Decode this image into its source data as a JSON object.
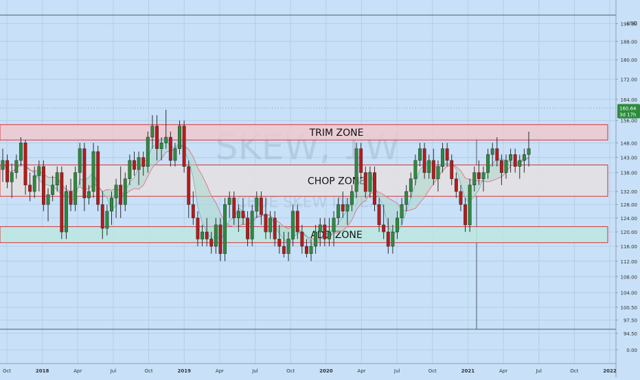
{
  "chart_data": {
    "type": "candlestick",
    "watermark": {
      "symbol": "SKEW, 1W",
      "name": "CBOE SKEW INDEX"
    },
    "currency": "USD",
    "y_scale": "log",
    "ylim": [
      88,
      200
    ],
    "y_ticks": [
      "0.00",
      "94.50",
      "97.50",
      "100.50",
      "104.00",
      "108.00",
      "112.00",
      "116.00",
      "120.00",
      "124.00",
      "128.00",
      "132.00",
      "138.00",
      "143.00",
      "148.00",
      "156.00",
      "164.00",
      "172.00",
      "180.00",
      "188.00",
      "196.00"
    ],
    "x_ticks": [
      "Oct",
      "2018",
      "Apr",
      "Jul",
      "Oct",
      "2019",
      "Apr",
      "Jul",
      "Oct",
      "2020",
      "Apr",
      "Jul",
      "Oct",
      "2021",
      "Apr",
      "Jul",
      "Oct",
      "2022"
    ],
    "last_price": {
      "value": "160.64",
      "countdown": "3d 17h"
    },
    "zones": [
      {
        "label": "TRIM ZONE",
        "from": 149,
        "to": 154.5,
        "color": "#f0c8cf"
      },
      {
        "label": "CHOP ZONE",
        "from": 130.5,
        "to": 140.5,
        "color": "#e5e0e2"
      },
      {
        "label": "ADD ZONE",
        "from": 117.0,
        "to": 121.5,
        "color": "#bce6e0"
      }
    ],
    "series": [
      {
        "name": "",
        "values": [
          [
            139,
            146,
            135,
            142
          ],
          [
            142,
            144,
            133,
            135
          ],
          [
            135,
            141,
            130,
            138
          ],
          [
            138,
            144,
            136,
            142
          ],
          [
            142,
            150,
            140,
            148
          ],
          [
            148,
            149,
            131,
            134
          ],
          [
            134,
            138,
            129,
            132
          ],
          [
            132,
            140,
            130,
            137
          ],
          [
            137,
            142,
            132,
            140
          ],
          [
            140,
            142,
            126,
            128
          ],
          [
            128,
            133,
            123,
            131
          ],
          [
            131,
            137,
            129,
            134
          ],
          [
            134,
            140,
            132,
            138
          ],
          [
            138,
            140,
            118,
            120
          ],
          [
            120,
            134,
            118,
            132
          ],
          [
            132,
            136,
            126,
            128
          ],
          [
            128,
            140,
            126,
            138
          ],
          [
            138,
            148,
            134,
            146
          ],
          [
            146,
            148,
            126,
            130
          ],
          [
            130,
            134,
            128,
            132
          ],
          [
            132,
            148,
            130,
            145
          ],
          [
            145,
            147,
            126,
            128
          ],
          [
            128,
            132,
            118,
            121
          ],
          [
            121,
            128,
            119,
            126
          ],
          [
            126,
            132,
            122,
            130
          ],
          [
            130,
            136,
            124,
            134
          ],
          [
            134,
            140,
            124,
            128
          ],
          [
            128,
            138,
            126,
            136
          ],
          [
            136,
            144,
            134,
            142
          ],
          [
            142,
            145,
            137,
            139
          ],
          [
            139,
            145,
            134,
            143
          ],
          [
            143,
            145,
            137,
            140
          ],
          [
            140,
            152,
            138,
            150
          ],
          [
            150,
            158,
            146,
            154
          ],
          [
            154,
            158,
            142,
            146
          ],
          [
            146,
            150,
            142,
            148
          ],
          [
            148,
            160,
            146,
            150
          ],
          [
            150,
            152,
            140,
            142
          ],
          [
            142,
            148,
            140,
            146
          ],
          [
            146,
            156,
            144,
            154
          ],
          [
            154,
            156,
            138,
            140
          ],
          [
            140,
            142,
            124,
            128
          ],
          [
            128,
            132,
            122,
            124
          ],
          [
            124,
            126,
            116,
            118
          ],
          [
            118,
            122,
            116,
            120
          ],
          [
            120,
            124,
            116,
            118
          ],
          [
            118,
            120,
            114,
            116
          ],
          [
            116,
            124,
            114,
            122
          ],
          [
            122,
            124,
            112,
            114
          ],
          [
            114,
            130,
            112,
            128
          ],
          [
            128,
            132,
            124,
            130
          ],
          [
            130,
            132,
            122,
            124
          ],
          [
            124,
            128,
            120,
            126
          ],
          [
            126,
            130,
            122,
            124
          ],
          [
            124,
            126,
            116,
            118
          ],
          [
            118,
            128,
            116,
            126
          ],
          [
            126,
            132,
            124,
            130
          ],
          [
            130,
            132,
            122,
            125
          ],
          [
            125,
            130,
            118,
            120
          ],
          [
            120,
            126,
            118,
            124
          ],
          [
            124,
            126,
            116,
            118
          ],
          [
            118,
            122,
            114,
            116
          ],
          [
            116,
            120,
            113,
            114
          ],
          [
            114,
            120,
            112,
            118
          ],
          [
            118,
            128,
            116,
            126
          ],
          [
            126,
            128,
            118,
            120
          ],
          [
            120,
            122,
            114,
            116
          ],
          [
            116,
            118,
            113,
            114
          ],
          [
            114,
            118,
            112,
            116
          ],
          [
            116,
            122,
            114,
            120
          ],
          [
            120,
            124,
            116,
            122
          ],
          [
            122,
            124,
            116,
            118
          ],
          [
            118,
            124,
            116,
            120
          ],
          [
            120,
            126,
            116,
            124
          ],
          [
            124,
            130,
            122,
            128
          ],
          [
            128,
            132,
            124,
            126
          ],
          [
            126,
            130,
            122,
            128
          ],
          [
            128,
            134,
            126,
            132
          ],
          [
            132,
            148,
            130,
            146
          ],
          [
            146,
            148,
            136,
            138
          ],
          [
            138,
            140,
            130,
            132
          ],
          [
            132,
            140,
            130,
            138
          ],
          [
            138,
            140,
            126,
            128
          ],
          [
            128,
            130,
            120,
            122
          ],
          [
            122,
            128,
            118,
            120
          ],
          [
            120,
            124,
            114,
            116
          ],
          [
            116,
            122,
            114,
            120
          ],
          [
            120,
            126,
            118,
            124
          ],
          [
            124,
            130,
            122,
            128
          ],
          [
            128,
            134,
            126,
            132
          ],
          [
            132,
            138,
            130,
            136
          ],
          [
            136,
            144,
            134,
            142
          ],
          [
            142,
            148,
            140,
            146
          ],
          [
            146,
            148,
            136,
            138
          ],
          [
            138,
            144,
            136,
            142
          ],
          [
            142,
            146,
            134,
            136
          ],
          [
            136,
            142,
            132,
            140
          ],
          [
            140,
            148,
            138,
            146
          ],
          [
            146,
            148,
            140,
            142
          ],
          [
            142,
            144,
            134,
            136
          ],
          [
            136,
            138,
            130,
            132
          ],
          [
            132,
            134,
            126,
            128
          ],
          [
            128,
            130,
            120,
            122
          ],
          [
            122,
            136,
            120,
            134
          ],
          [
            134,
            140,
            132,
            138
          ],
          [
            138,
            142,
            134,
            136
          ],
          [
            136,
            140,
            132,
            138
          ],
          [
            138,
            146,
            136,
            144
          ],
          [
            144,
            148,
            140,
            146
          ],
          [
            146,
            150,
            140,
            142
          ],
          [
            142,
            144,
            134,
            138
          ],
          [
            138,
            144,
            136,
            142
          ],
          [
            142,
            146,
            138,
            144
          ],
          [
            144,
            146,
            138,
            140
          ],
          [
            140,
            144,
            136,
            142
          ],
          [
            142,
            146,
            138,
            144
          ],
          [
            144,
            152,
            140,
            146
          ]
        ]
      }
    ]
  }
}
